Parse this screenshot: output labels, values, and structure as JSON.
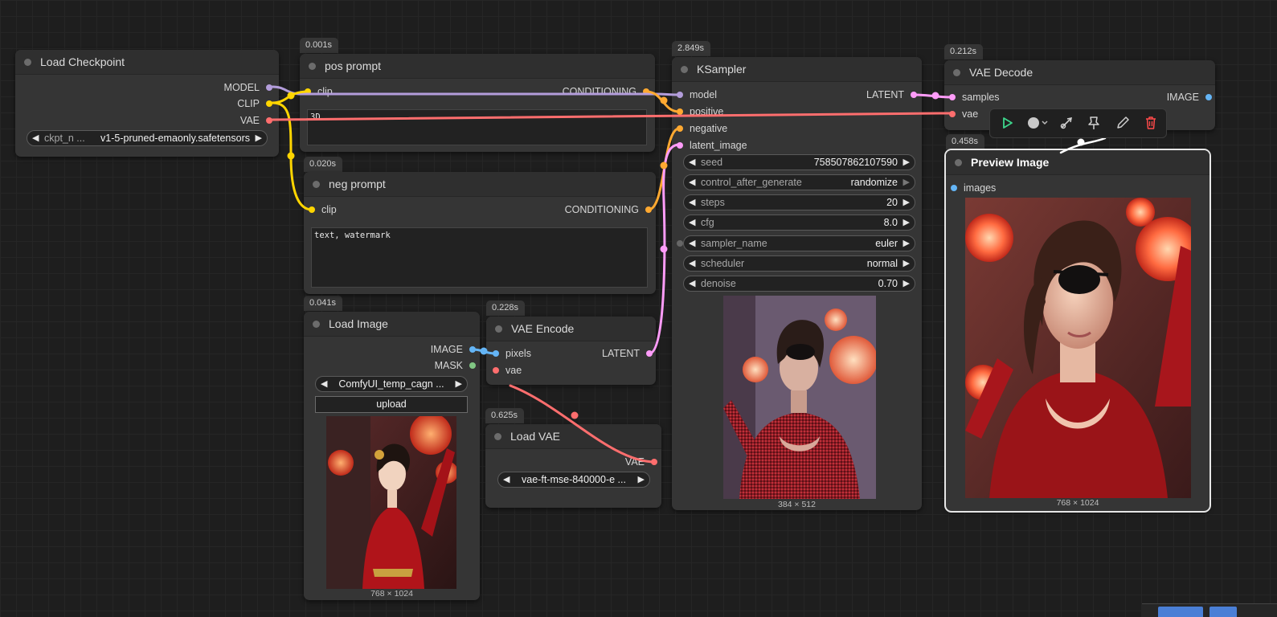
{
  "nodes": {
    "load_checkpoint": {
      "title": "Load Checkpoint",
      "outputs": [
        "MODEL",
        "CLIP",
        "VAE"
      ],
      "widget": {
        "label": "ckpt_n ...",
        "value": "v1-5-pruned-emaonly.safetensors"
      }
    },
    "pos_prompt": {
      "timing": "0.001s",
      "title": "pos prompt",
      "input": "clip",
      "output": "CONDITIONING",
      "text": "3D"
    },
    "neg_prompt": {
      "timing": "0.020s",
      "title": "neg prompt",
      "input": "clip",
      "output": "CONDITIONING",
      "text": "text, watermark"
    },
    "load_image": {
      "timing": "0.041s",
      "title": "Load Image",
      "outputs": [
        "IMAGE",
        "MASK"
      ],
      "image_select": "ComfyUI_temp_cagn ...",
      "upload_label": "upload",
      "dims": "768 × 1024"
    },
    "vae_encode": {
      "timing": "0.228s",
      "title": "VAE Encode",
      "inputs": [
        "pixels",
        "vae"
      ],
      "output": "LATENT"
    },
    "load_vae": {
      "timing": "0.625s",
      "title": "Load VAE",
      "output": "VAE",
      "vae_select": "vae-ft-mse-840000-e ..."
    },
    "ksampler": {
      "timing": "2.849s",
      "title": "KSampler",
      "inputs": [
        "model",
        "positive",
        "negative",
        "latent_image"
      ],
      "output": "LATENT",
      "widgets": [
        {
          "label": "seed",
          "value": "758507862107590"
        },
        {
          "label": "control_after_generate",
          "value": "randomize"
        },
        {
          "label": "steps",
          "value": "20"
        },
        {
          "label": "cfg",
          "value": "8.0"
        },
        {
          "label": "sampler_name",
          "value": "euler"
        },
        {
          "label": "scheduler",
          "value": "normal"
        },
        {
          "label": "denoise",
          "value": "0.70"
        }
      ],
      "dims": "384 × 512"
    },
    "vae_decode": {
      "timing": "0.212s",
      "title": "VAE Decode",
      "inputs": [
        "samples",
        "vae"
      ],
      "output": "IMAGE"
    },
    "preview_image": {
      "timing": "0.458s",
      "title": "Preview Image",
      "input": "images",
      "dims": "768 × 1024"
    }
  },
  "toolbar_icons": [
    "play-icon",
    "color-circle-icon",
    "bypass-icon",
    "pin-icon",
    "pencil-icon",
    "trash-icon"
  ],
  "colors": {
    "model": "#b39ddb",
    "clip": "#ffd500",
    "vae": "#ff6e6e",
    "conditioning": "#ffa931",
    "latent": "#ff9cf9",
    "image": "#64b5f6",
    "mask": "#81c784",
    "selected_outline": "#e6e6e6"
  }
}
